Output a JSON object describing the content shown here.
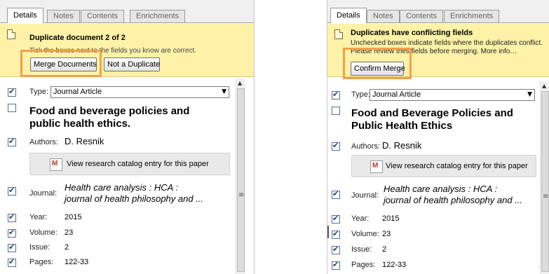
{
  "left": {
    "tabs": [
      "Details",
      "Notes",
      "Contents",
      "Enrichments"
    ],
    "notice": {
      "title": "Duplicate document 2 of 2",
      "message": "Tick the boxes next to the fields you know are correct.",
      "primary_button": "Merge Documents",
      "secondary_button": "Not a Duplicate"
    },
    "type_label": "Type:",
    "type_value": "Journal Article",
    "title": "Food and beverage policies and public health ethics.",
    "authors_label": "Authors:",
    "authors_value": "D. Resnik",
    "catalog_button": "View research catalog entry for this paper",
    "journal_label": "Journal:",
    "journal_line1": "Health care analysis : HCA :",
    "journal_line2": "journal of health philosophy and ...",
    "year_label": "Year:",
    "year_value": "2015",
    "volume_label": "Volume:",
    "volume_value": "23",
    "issue_label": "Issue:",
    "issue_value": "2",
    "pages_label": "Pages:",
    "pages_value": "122-33"
  },
  "right": {
    "tabs": [
      "Details",
      "Notes",
      "Contents",
      "Enrichments"
    ],
    "notice": {
      "title": "Duplicates have conflicting fields",
      "message_line1": "Unchecked boxes indicate fields where the duplicates conflict.",
      "message_line2": "Please review thes   fields before merging.",
      "more_info": "More info…",
      "primary_button": "Confirm Merge"
    },
    "type_label": "Type:",
    "type_value": "Journal Article",
    "title": "Food and Beverage Policies and Public Health Ethics",
    "authors_label": "Authors:",
    "authors_value": "D. Resnik",
    "catalog_button": "View research catalog entry for this paper",
    "journal_label": "Journal:",
    "journal_line1": "Health care analysis : HCA :",
    "journal_line2": "journal of health philosophy and ...",
    "year_label": "Year:",
    "year_value": "2015",
    "volume_label": "Volume:",
    "volume_value": "23",
    "issue_label": "Issue:",
    "issue_value": "2",
    "pages_label": "Pages:",
    "pages_value": "122-33"
  },
  "icons": {
    "document": "document-icon",
    "catalog": "research-catalog-icon",
    "checkbox_checked": "check-icon",
    "dropdown": "chevron-down-icon",
    "scroll_up": "scroll-up-arrow-icon",
    "grip": "scrollbar-grip-icon"
  },
  "colors": {
    "notice_bg": "#fdf2a8",
    "highlight": "#f4a04a",
    "checkbox_check": "#1f3d78"
  }
}
